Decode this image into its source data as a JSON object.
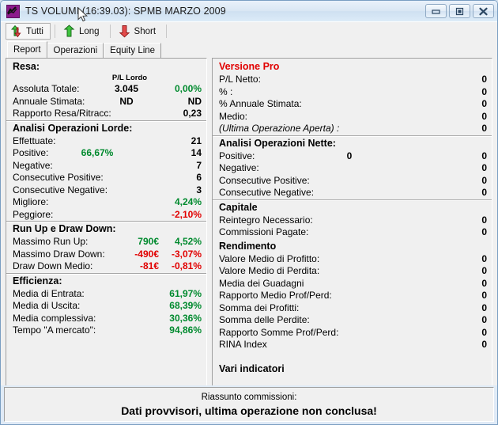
{
  "window": {
    "title": "TS VOLUMI (16:39.03): SPMB MARZO 2009",
    "icon": "chart-line-icon",
    "minimize_label": "minimize-icon",
    "restore_label": "restore-icon",
    "close_label": "close-icon"
  },
  "toolbar": {
    "buttons": [
      {
        "label": "Tutti",
        "icon": "up-down-arrow-icon",
        "active": true
      },
      {
        "label": "Long",
        "icon": "green-up-arrow-icon",
        "active": false
      },
      {
        "label": "Short",
        "icon": "red-down-arrow-icon",
        "active": false
      }
    ]
  },
  "tabs": [
    {
      "label": "Report",
      "selected": true
    },
    {
      "label": "Operazioni",
      "selected": false
    },
    {
      "label": "Equity Line",
      "selected": false
    }
  ],
  "left_panel": {
    "groups": [
      {
        "title": "Resa:",
        "column_header": "P/L Lordo",
        "rows": [
          {
            "label": "Assoluta Totale:",
            "mid": "3.045",
            "mid_color": "#000000",
            "value": "0,00%",
            "value_color": "#008a2e"
          },
          {
            "label": "Annuale Stimata:",
            "mid": "ND",
            "mid_color": "#000000",
            "value": "ND",
            "value_color": "#000000"
          },
          {
            "label": "Rapporto Resa/Ritracc:",
            "mid": "",
            "mid_color": "#000000",
            "value": "0,23",
            "value_color": "#000000"
          }
        ]
      },
      {
        "title": "Analisi Operazioni Lorde:",
        "column_header": "",
        "rows": [
          {
            "label": "Effettuate:",
            "mid": "",
            "mid_color": "#000000",
            "value": "21",
            "value_color": "#000000"
          },
          {
            "label": "Positive:",
            "mid": "66,67%",
            "mid_color": "#008a2e",
            "value": "14",
            "value_color": "#000000"
          },
          {
            "label": "Negative:",
            "mid": "",
            "mid_color": "#000000",
            "value": "7",
            "value_color": "#000000"
          },
          {
            "label": "Consecutive Positive:",
            "mid": "",
            "mid_color": "#000000",
            "value": "6",
            "value_color": "#000000"
          },
          {
            "label": "Consecutive Negative:",
            "mid": "",
            "mid_color": "#000000",
            "value": "3",
            "value_color": "#000000"
          },
          {
            "label": "Migliore:",
            "mid": "",
            "mid_color": "#000000",
            "value": "4,24%",
            "value_color": "#008a2e"
          },
          {
            "label": "Peggiore:",
            "mid": "",
            "mid_color": "#000000",
            "value": "-2,10%",
            "value_color": "#e10000"
          }
        ]
      },
      {
        "title": "Run Up e Draw Down:",
        "column_header": "",
        "rows": [
          {
            "label": "Massimo Run Up:",
            "mid": "",
            "mid_color": "#000000",
            "amount": "790€",
            "amount_color": "#008a2e",
            "value": "4,52%",
            "value_color": "#008a2e"
          },
          {
            "label": "Massimo Draw Down:",
            "mid": "",
            "mid_color": "#000000",
            "amount": "-490€",
            "amount_color": "#e10000",
            "value": "-3,07%",
            "value_color": "#e10000"
          },
          {
            "label": "Draw Down Medio:",
            "mid": "",
            "mid_color": "#000000",
            "amount": "-81€",
            "amount_color": "#e10000",
            "value": "-0,81%",
            "value_color": "#e10000"
          }
        ]
      },
      {
        "title": "Efficienza:",
        "column_header": "",
        "rows": [
          {
            "label": "Media di Entrata:",
            "mid": "",
            "mid_color": "#000000",
            "value": "61,97%",
            "value_color": "#008a2e"
          },
          {
            "label": "Media di Uscita:",
            "mid": "",
            "mid_color": "#000000",
            "value": "68,39%",
            "value_color": "#008a2e"
          },
          {
            "label": "Media complessiva:",
            "mid": "",
            "mid_color": "#000000",
            "value": "30,36%",
            "value_color": "#008a2e"
          },
          {
            "label": "Tempo \"A mercato\":",
            "mid": "",
            "mid_color": "#000000",
            "value": "94,86%",
            "value_color": "#008a2e"
          }
        ]
      }
    ]
  },
  "right_panel": {
    "groups": [
      {
        "title": "Versione Pro",
        "title_color": "#e10000",
        "rows": [
          {
            "label": "P/L Netto:",
            "mid": "",
            "value": "0"
          },
          {
            "label": "% :",
            "mid": "",
            "value": "0"
          },
          {
            "label": "% Annuale Stimata:",
            "mid": "",
            "value": "0"
          },
          {
            "label": "Medio:",
            "mid": "",
            "value": "0"
          },
          {
            "label": "(Ultima Operazione Aperta) :",
            "mid": "",
            "value": "0",
            "italic": true
          }
        ]
      },
      {
        "title": "Analisi Operazioni Nette:",
        "title_color": "#000000",
        "rows": [
          {
            "label": "Positive:",
            "mid": "0",
            "value": "0"
          },
          {
            "label": "Negative:",
            "mid": "",
            "value": "0"
          },
          {
            "label": "Consecutive Positive:",
            "mid": "",
            "value": "0"
          },
          {
            "label": "Consecutive Negative:",
            "mid": "",
            "value": "0"
          }
        ]
      },
      {
        "title": "Capitale",
        "title_color": "#000000",
        "rows": [
          {
            "label": "Reintegro Necessario:",
            "mid": "",
            "value": "0"
          },
          {
            "label": "Commissioni Pagate:",
            "mid": "",
            "value": "0"
          }
        ]
      },
      {
        "title": "Rendimento",
        "title_color": "#000000",
        "rows": [
          {
            "label": "Valore Medio di Profitto:",
            "mid": "",
            "value": "0"
          },
          {
            "label": "Valore Medio di Perdita:",
            "mid": "",
            "value": "0"
          },
          {
            "label": "Media dei Guadagni",
            "mid": "",
            "value": "0"
          },
          {
            "label": "Rapporto Medio Prof/Perd:",
            "mid": "",
            "value": "0"
          },
          {
            "label": "Somma dei Profitti:",
            "mid": "",
            "value": "0"
          },
          {
            "label": "Somma delle Perdite:",
            "mid": "",
            "value": "0"
          },
          {
            "label": "Rapporto Somme Prof/Perd:",
            "mid": "",
            "value": "0"
          },
          {
            "label": "RINA Index",
            "mid": "",
            "value": "0"
          }
        ]
      },
      {
        "title": "Vari indicatori",
        "title_color": "#000000",
        "rows": []
      }
    ]
  },
  "footer": {
    "line1": "Riassunto commissioni:",
    "line2": "Dati provvisori, ultima operazione non conclusa!"
  }
}
